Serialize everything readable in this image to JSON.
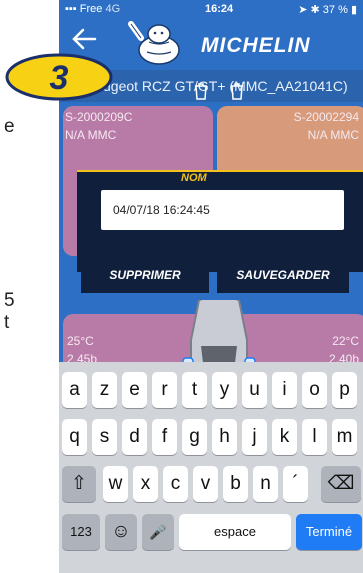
{
  "doc_fragments": [
    "e",
    "5",
    "t"
  ],
  "statusbar": {
    "carrier": "Free",
    "network": "4G",
    "time": "16:24",
    "battery": "37 %"
  },
  "header": {
    "brand": "MICHELIN",
    "vehicle_title": "ugeot RCZ GT/GT+ (MMC_AA21041C)"
  },
  "step_badge": "3",
  "cards": {
    "front_left": {
      "code": "S-2000209C",
      "label": "N/A MMC"
    },
    "front_right": {
      "code": "S-20002294",
      "label": "N/A MMC"
    },
    "rear_left": {
      "temp": "25°C",
      "pressure": "2.45b"
    },
    "rear_right": {
      "temp": "22°C",
      "pressure": "2.40b"
    }
  },
  "dialog": {
    "title": "NOM",
    "input_value": "04/07/18 16:24:45",
    "delete_label": "SUPPRIMER",
    "save_label": "SAUVEGARDER"
  },
  "keyboard": {
    "row1": [
      "a",
      "z",
      "e",
      "r",
      "t",
      "y",
      "u",
      "i",
      "o",
      "p"
    ],
    "row2": [
      "q",
      "s",
      "d",
      "f",
      "g",
      "h",
      "j",
      "k",
      "l",
      "m"
    ],
    "row3": [
      "w",
      "x",
      "c",
      "v",
      "b",
      "n",
      "´"
    ],
    "numbers_label": "123",
    "space_label": "espace",
    "return_label": "Terminé"
  },
  "colors": {
    "accent": "#f2c21b",
    "header_blue": "#2c6fc4",
    "dialog_navy": "#0f1f3c",
    "card_purple": "#b87ba8",
    "card_peach": "#d79a7a"
  }
}
